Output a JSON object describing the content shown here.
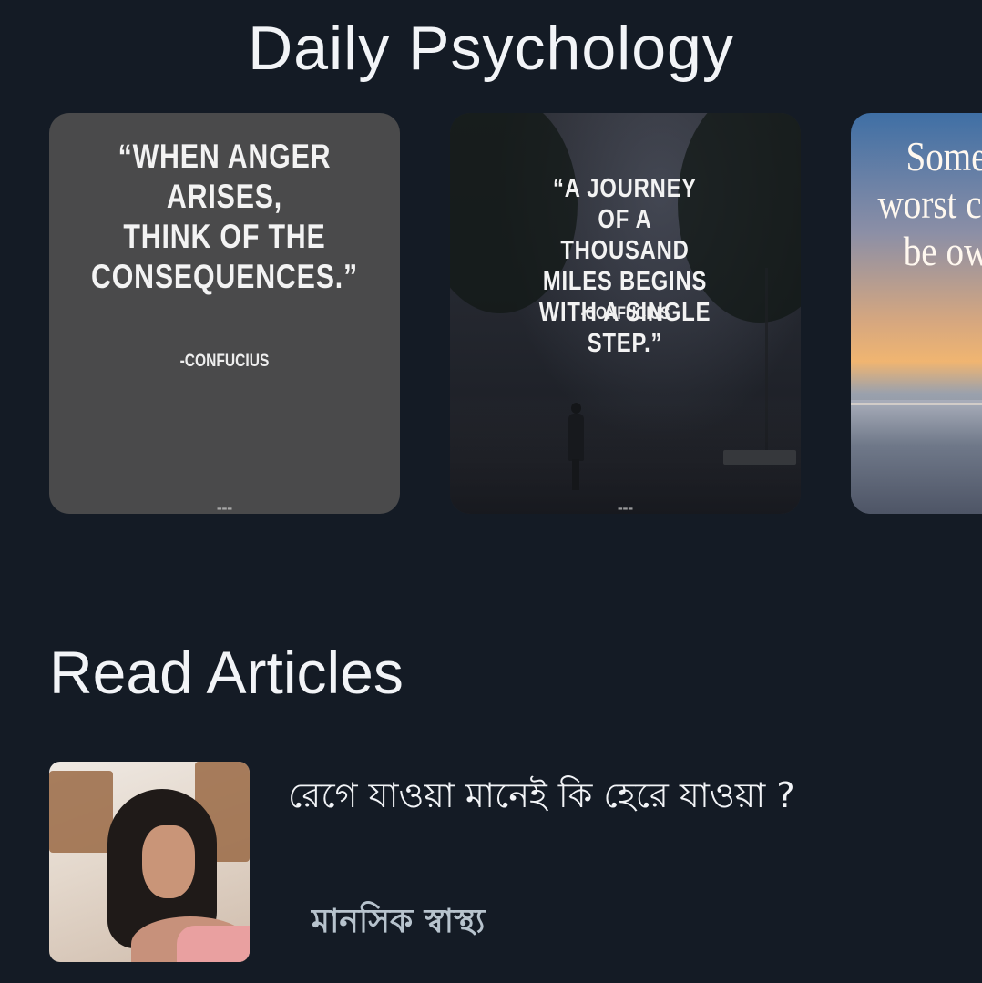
{
  "header": {
    "title": "Daily Psychology"
  },
  "quote_cards": [
    {
      "quote": "“WHEN ANGER ARISES,\nTHINK OF THE CONSEQUENCES.”",
      "author": "-CONFUCIUS",
      "background_color": "#4a4a4b"
    },
    {
      "quote": "“A JOURNEY OF A THOUSAND MILES BEGINS WITH A SINGLE STEP.”",
      "author": "-CONFUCIUS"
    },
    {
      "quote": "Some worst can be ow"
    }
  ],
  "articles_section": {
    "title": "Read Articles",
    "items": [
      {
        "title": "রেগে যাওয়া মানেই কি হেরে যাওয়া ?",
        "category": "মানসিক স্বাস্থ্য"
      }
    ]
  },
  "colors": {
    "background": "#141b25",
    "text_primary": "#f2f4f7",
    "category_text": "#b7c3cd"
  }
}
